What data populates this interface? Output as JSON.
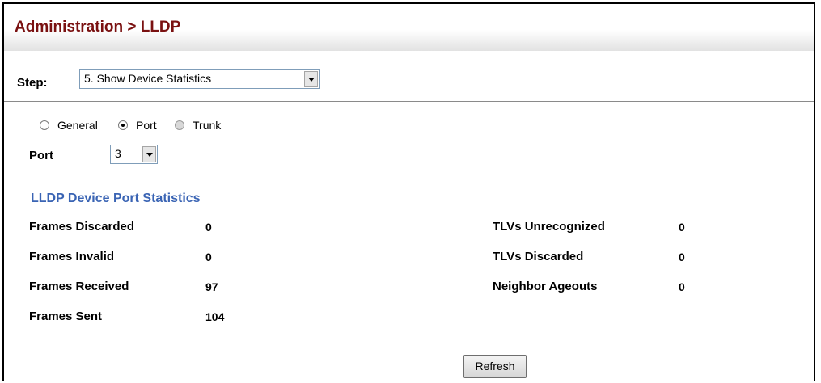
{
  "header": {
    "title": "Administration > LLDP"
  },
  "step": {
    "label": "Step:",
    "selected": "5. Show Device Statistics"
  },
  "scope": {
    "options": [
      {
        "label": "General",
        "state": "unchecked"
      },
      {
        "label": "Port",
        "state": "checked"
      },
      {
        "label": "Trunk",
        "state": "disabled"
      }
    ]
  },
  "port": {
    "label": "Port",
    "selected": "3"
  },
  "stats": {
    "title": "LLDP Device Port Statistics",
    "left": [
      {
        "label": "Frames Discarded",
        "value": "0"
      },
      {
        "label": "Frames Invalid",
        "value": "0"
      },
      {
        "label": "Frames Received",
        "value": "97"
      },
      {
        "label": "Frames Sent",
        "value": "104"
      }
    ],
    "right": [
      {
        "label": "TLVs Unrecognized",
        "value": "0"
      },
      {
        "label": "TLVs Discarded",
        "value": "0"
      },
      {
        "label": "Neighbor Ageouts",
        "value": "0"
      }
    ]
  },
  "actions": {
    "refresh_label": "Refresh"
  }
}
